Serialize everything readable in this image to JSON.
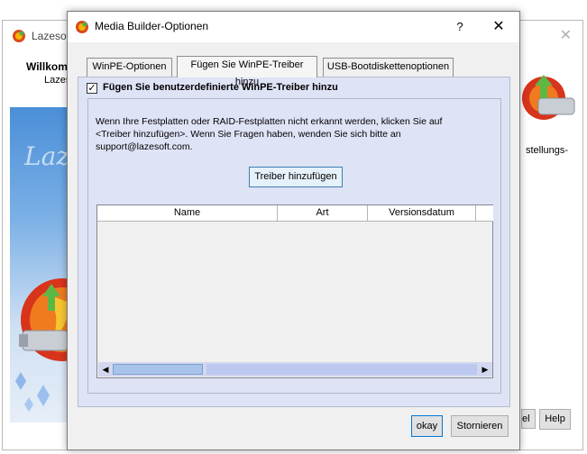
{
  "background_window": {
    "title": "Lazesoft",
    "close_glyph": "✕",
    "welcome_bold": "Willkomm",
    "welcome_sub": "Lazes",
    "brand_text": "Laz",
    "right_text": "stellungs-",
    "cancel_partial": "el",
    "help_label": "Help"
  },
  "dialog": {
    "title": "Media Builder-Optionen",
    "help_glyph": "?",
    "close_glyph": "✕",
    "tabs": [
      {
        "label": "WinPE-Optionen",
        "active": false
      },
      {
        "label": "Fügen Sie WinPE-Treiber hinzu",
        "active": true
      },
      {
        "label": "USB-Bootdiskettenoptionen",
        "active": false
      }
    ],
    "checkbox": {
      "label": "Fügen Sie benutzerdefinierte WinPE-Treiber hinzu",
      "checked": true,
      "mark": "✓"
    },
    "info_text": "Wenn Ihre Festplatten oder RAID-Festplatten nicht erkannt werden, klicken Sie auf <Treiber hinzufügen>. Wenn Sie Fragen haben, wenden Sie sich bitte an support@lazesoft.com.",
    "add_driver_button": "Treiber hinzufügen",
    "list_columns": [
      "Name",
      "Art",
      "Versionsdatum",
      ""
    ],
    "scroll_left_glyph": "◀",
    "scroll_right_glyph": "▶",
    "ok_button": "okay",
    "cancel_button": "Stornieren"
  },
  "colors": {
    "tab_panel_bg": "#dfe3f6",
    "default_button_border": "#0078d7"
  }
}
